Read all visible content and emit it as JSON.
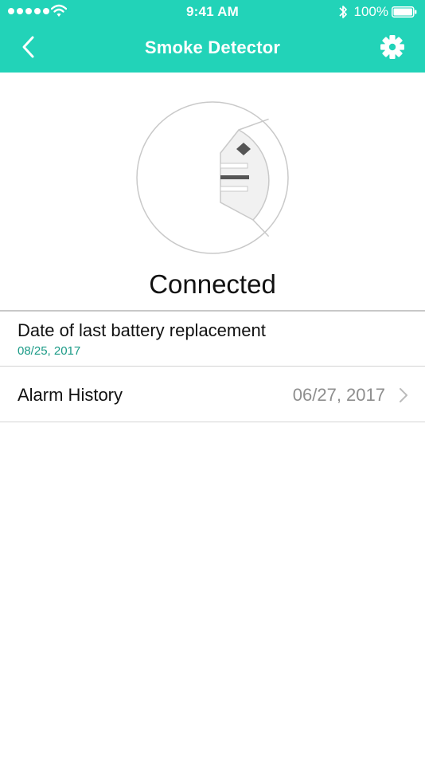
{
  "status_bar": {
    "time": "9:41 AM",
    "battery_percent": "100%",
    "signal_icon": "signal-dots-icon",
    "wifi_icon": "wifi-icon",
    "bluetooth_icon": "bluetooth-icon",
    "battery_icon": "battery-icon"
  },
  "nav": {
    "title": "Smoke Detector",
    "back_icon": "chevron-left-icon",
    "settings_icon": "gear-icon"
  },
  "device": {
    "status": "Connected",
    "illustration_icon": "smoke-detector-icon"
  },
  "rows": {
    "battery": {
      "label": "Date of last battery replacement",
      "value": "08/25, 2017"
    },
    "alarm_history": {
      "label": "Alarm History",
      "value": "06/27, 2017",
      "chevron_icon": "chevron-right-icon"
    }
  },
  "colors": {
    "header_bg": "#22d3b8",
    "accent_text": "#1a9a86",
    "secondary_text": "#8e8e8e"
  }
}
